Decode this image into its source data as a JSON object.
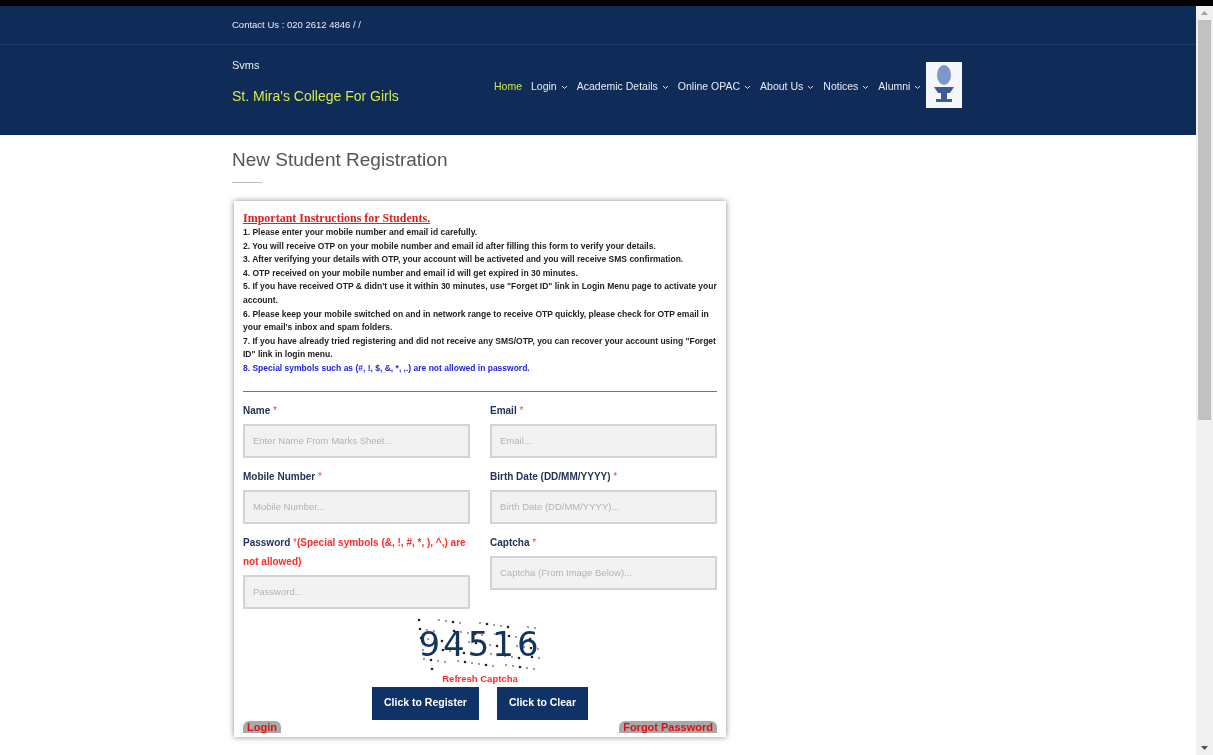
{
  "header": {
    "contact": "Contact Us : 020 2612 4846 / /",
    "org": "Svms",
    "college": "St. Mira's College For Girls",
    "nav": [
      {
        "label": "Home",
        "selected": true,
        "has_dropdown": false
      },
      {
        "label": "Login",
        "selected": false,
        "has_dropdown": true
      },
      {
        "label": "Academic Details",
        "selected": false,
        "has_dropdown": true
      },
      {
        "label": "Online OPAC",
        "selected": false,
        "has_dropdown": true
      },
      {
        "label": "About Us",
        "selected": false,
        "has_dropdown": true
      },
      {
        "label": "Notices",
        "selected": false,
        "has_dropdown": true
      },
      {
        "label": "Alumni",
        "selected": false,
        "has_dropdown": true
      }
    ]
  },
  "page_title": "New Student Registration",
  "instructions": {
    "heading": "Important Instructions for Students.",
    "items": [
      {
        "kind": "normal",
        "text": "1. Please enter your mobile number and email id carefully."
      },
      {
        "kind": "normal",
        "text": "2. You will receive OTP on your mobile number and email id after filling this form to verify your details."
      },
      {
        "kind": "normal",
        "text": "3. After verifying your details with OTP, your account will be activeted and you will receive SMS confirmation."
      },
      {
        "kind": "normal",
        "text": "4. OTP received on your mobile number and email id will get expired in 30 minutes."
      },
      {
        "kind": "normal",
        "text": "5. If you have received OTP & didn't use it within 30 minutes, use \"Forget ID\" link in Login Menu page to activate your account."
      },
      {
        "kind": "normal",
        "text": "6. Please keep your mobile switched on and in network range to receive OTP quickly, please check for OTP email in your email's inbox and spam folders."
      },
      {
        "kind": "normal",
        "text": "7. If you have already tried registering and did not receive any SMS/OTP, you can recover your account using \"Forget ID\" link in login menu."
      },
      {
        "kind": "highlight",
        "text": "8. Special symbols such as (#, !, $, &, *, ,.) are not allowed in password."
      }
    ]
  },
  "form": {
    "fields": [
      {
        "label": "Name",
        "mark": "*",
        "placeholder": "Enter Name From Marks Sheet..."
      },
      {
        "label": "Email",
        "mark": "*",
        "placeholder": "Email..."
      },
      {
        "label": "Mobile Number",
        "mark": "*",
        "placeholder": "Mobile Number..."
      },
      {
        "label": "Birth Date (DD/MM/YYYY)",
        "mark": "*",
        "placeholder": "Birth Date (DD/MM/YYYY)..."
      },
      {
        "label": "Password",
        "mark": "*",
        "note": "(Special symbols (&, !, #, *, ), ^,) are not allowed)",
        "placeholder": "Password..."
      },
      {
        "label": "Captcha",
        "mark": "*",
        "placeholder": "Captcha (From Image Below)..."
      }
    ],
    "captcha": "94516",
    "refresh": "Refresh Captcha",
    "buttons": [
      "Click to Register",
      "Click to Clear"
    ],
    "links": [
      "Login",
      "Forgot Password"
    ]
  }
}
